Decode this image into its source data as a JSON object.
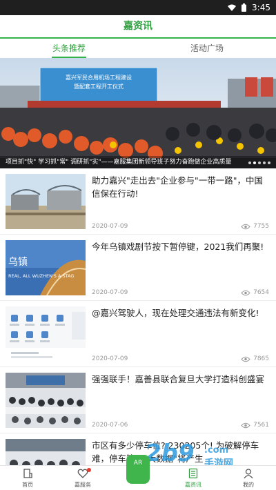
{
  "status_bar": {
    "time": "3:45"
  },
  "header": {
    "title": "嘉资讯"
  },
  "tabs": [
    {
      "label": "头条推荐",
      "active": true
    },
    {
      "label": "活动广场",
      "active": false
    }
  ],
  "banner": {
    "sign_line1": "嘉兴军民合用机场工程建设",
    "sign_line2": "暨配套工程开工仪式",
    "caption": "项目抓\"快\" 学习抓\"常\" 调研抓\"实\"——嘉服集团新领导班子努力奋跑做企业高质量",
    "dot_count": 5,
    "active_dot": 1
  },
  "news": [
    {
      "title": "助力嘉兴\"走出去\"企业参与\"一带一路\"，中国信保在行动!",
      "date": "2020-07-09",
      "views": "7755"
    },
    {
      "title": "今年乌镇戏剧节按下暂停键，2021我们再聚!",
      "date": "2020-07-09",
      "views": "7654",
      "thumb_text_1": "乌镇",
      "thumb_text_2": "REAL, ALL WUZHEN'S A STAG"
    },
    {
      "title": "@嘉兴驾驶人，现在处理交通违法有新变化!",
      "date": "2020-07-09",
      "views": "7865"
    },
    {
      "title": "强强联手！嘉善县联合复旦大学打造科创盛宴",
      "date": "2020-07-06",
      "views": "7561"
    },
    {
      "title": "市区有多少停车位? 230205个! 为破解停车难，停车管理\"大数据\"将产生",
      "date": "",
      "views": ""
    }
  ],
  "bottom_nav": [
    {
      "label": "首页",
      "icon": "home-icon",
      "active": false
    },
    {
      "label": "嘉服务",
      "icon": "heart-icon",
      "active": false,
      "badge": true
    },
    {
      "label": "",
      "icon": "center-app-icon",
      "center_text": "AR",
      "active": false
    },
    {
      "label": "嘉资讯",
      "icon": "news-icon",
      "active": true
    },
    {
      "label": "我的",
      "icon": "profile-icon",
      "active": false
    }
  ],
  "watermark": {
    "text": "2b9",
    "sub": "手游网",
    "domain": ".com"
  },
  "colors": {
    "accent": "#34b24a",
    "accent_text": "#2e9e3e",
    "badge": "#e83b2f"
  }
}
